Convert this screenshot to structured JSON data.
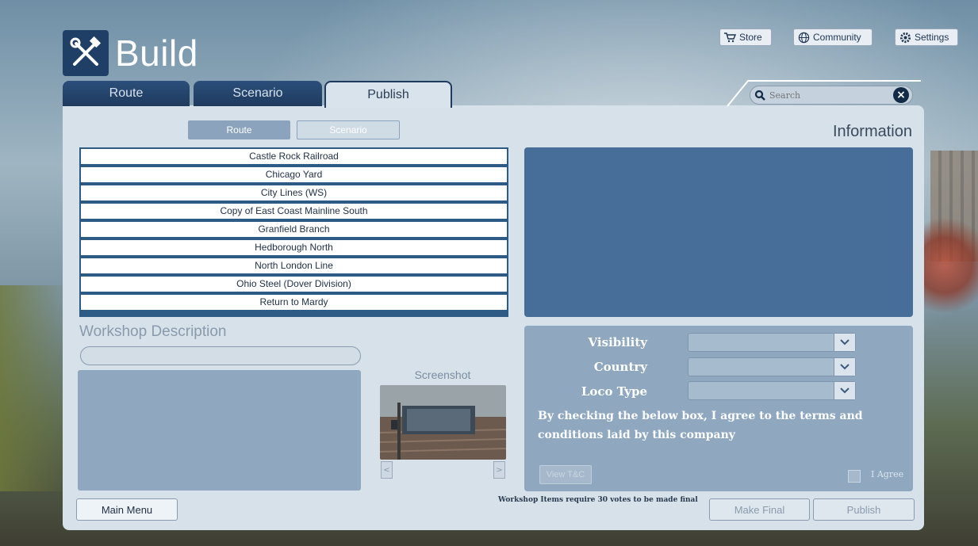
{
  "app": {
    "title": "Build"
  },
  "top_buttons": {
    "store": "Store",
    "community": "Community",
    "settings": "Settings"
  },
  "tabs": [
    {
      "label": "Route",
      "active": false
    },
    {
      "label": "Scenario",
      "active": false
    },
    {
      "label": "Publish",
      "active": true
    }
  ],
  "search": {
    "placeholder": "Search"
  },
  "segments": {
    "route": "Route",
    "scenario": "Scenario"
  },
  "information": {
    "heading": "Information"
  },
  "routes": [
    "Castle Rock Railroad",
    "Chicago Yard",
    "City Lines (WS)",
    "Copy of East Coast Mainline South",
    "Granfield Branch",
    "Hedborough North",
    "North London Line",
    "Ohio Steel (Dover Division)",
    "Return to Mardy"
  ],
  "workshop": {
    "heading": "Workshop Description"
  },
  "screenshot": {
    "heading": "Screenshot",
    "prev": "<",
    "next": ">"
  },
  "options": {
    "visibility_label": "Visibility",
    "country_label": "Country",
    "loco_label": "Loco Type",
    "terms": "By checking the below box, I agree to the terms and conditions laid by this company",
    "view_tc": "View T&C",
    "agree": "I Agree"
  },
  "footer": {
    "main_menu": "Main Menu",
    "note": "Workshop Items require 30 votes to be made final",
    "make_final": "Make Final",
    "publish": "Publish"
  },
  "colors": {
    "tab_active": "#d8e3ec",
    "tab_inactive": "#1f3a5e",
    "list_bg": "#2e5a86",
    "info_box": "#476e98"
  }
}
